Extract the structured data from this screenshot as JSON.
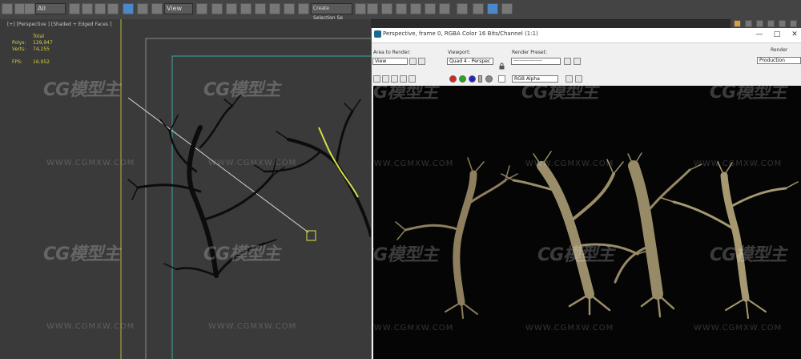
{
  "toolbar": {
    "selection_filter": "All",
    "view_dropdown": "View",
    "named_selection": "Create Selection Se"
  },
  "viewport": {
    "label": "[+] [Perspective ] [Shaded + Edged Faces ]",
    "stats": {
      "total_label": "Total",
      "polys_label": "Polys:",
      "polys_value": "129,947",
      "verts_label": "Verts:",
      "verts_value": "74,255",
      "fps_label": "FPS:",
      "fps_value": "16.952"
    }
  },
  "frame_window": {
    "title": "Perspective, frame 0, RGBA Color 16 Bits/Channel (1:1)",
    "area_to_render_label": "Area to Render:",
    "area_to_render_value": "View",
    "viewport_label": "Viewport:",
    "viewport_value": "Quad 4 - Perspec",
    "render_preset_label": "Render Preset:",
    "render_preset_value": "--------------------",
    "render_label": "Render",
    "render_value": "Production",
    "channel_value": "RGB Alpha"
  },
  "watermark": {
    "logo_text": "CG模型主",
    "url_text": "WWW.CGMXW.COM"
  },
  "colors": {
    "stats_yellow": "#d6cf3a",
    "frame_cyan": "#3fa7a0",
    "frame_yellow": "#b8b83a",
    "selection_yellow": "#d7e04a",
    "render_bg": "#050505"
  }
}
